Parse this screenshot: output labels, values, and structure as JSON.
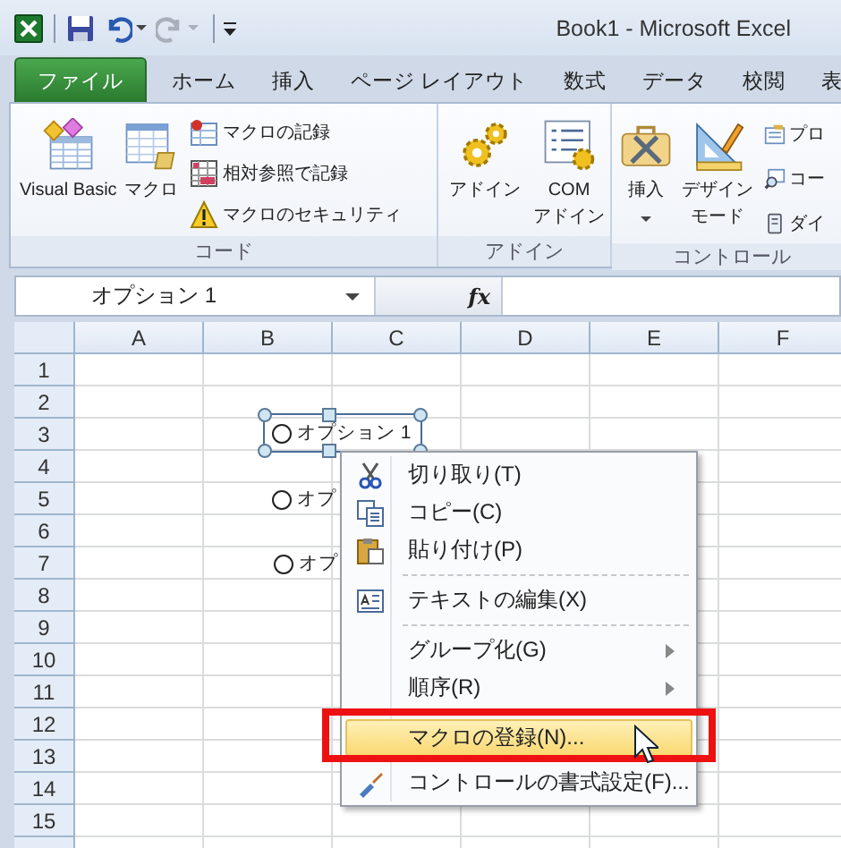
{
  "title_bar": {
    "title": "Book1  -  Microsoft Excel"
  },
  "quick_access": [
    {
      "kind": "save",
      "disabled": false,
      "dropdown": false
    },
    {
      "kind": "undo",
      "disabled": false,
      "dropdown": true
    },
    {
      "kind": "redo",
      "disabled": true,
      "dropdown": true
    },
    {
      "kind": "customize",
      "disabled": false,
      "dropdown": false
    }
  ],
  "tabs": [
    {
      "label": "ファイル",
      "kind": "file",
      "selected": false
    },
    {
      "label": "ホーム",
      "kind": "tab",
      "selected": false
    },
    {
      "label": "挿入",
      "kind": "tab",
      "selected": false
    },
    {
      "label": "ページ レイアウト",
      "kind": "tab",
      "selected": false
    },
    {
      "label": "数式",
      "kind": "tab",
      "selected": false
    },
    {
      "label": "データ",
      "kind": "tab",
      "selected": false
    },
    {
      "label": "校閲",
      "kind": "tab",
      "selected": false
    },
    {
      "label": "表",
      "kind": "tab",
      "selected": false
    }
  ],
  "ribbon": {
    "groups": [
      {
        "label": "コード",
        "large_buttons": [
          {
            "lines": [
              "Visual Basic"
            ],
            "dropdown": false
          },
          {
            "lines": [
              "マクロ"
            ],
            "dropdown": false
          }
        ],
        "small_buttons": [
          "マクロの記録",
          "相対参照で記録",
          "マクロのセキュリティ"
        ]
      },
      {
        "label": "アドイン",
        "large_buttons": [
          {
            "lines": [
              "アドイン"
            ],
            "dropdown": false
          },
          {
            "lines": [
              "COM",
              "アドイン"
            ],
            "dropdown": false
          }
        ]
      },
      {
        "label": "コントロール",
        "large_buttons": [
          {
            "lines": [
              "挿入"
            ],
            "dropdown": true
          },
          {
            "lines": [
              "デザイン",
              "モード"
            ],
            "dropdown": false
          }
        ],
        "small_buttons": [
          "プロ",
          "コー",
          "ダイ"
        ]
      }
    ]
  },
  "formula_bar": {
    "name_box": "オプション 1",
    "function_button": "fx"
  },
  "sheet": {
    "columns": [
      "A",
      "B",
      "C",
      "D",
      "E",
      "F"
    ],
    "rows": [
      "1",
      "2",
      "3",
      "4",
      "5",
      "6",
      "7",
      "8",
      "9",
      "10",
      "11",
      "12",
      "13",
      "14",
      "15"
    ]
  },
  "option_buttons": [
    {
      "label": "オプション 1",
      "checked": false,
      "selected": true
    },
    {
      "label": "オプ",
      "checked": false,
      "selected": false
    },
    {
      "label": "オプ",
      "checked": false,
      "selected": false
    }
  ],
  "context_menu": {
    "items": [
      {
        "kind": "command",
        "label": "切り取り(T)",
        "submenu": false,
        "highlighted": false
      },
      {
        "kind": "command",
        "label": "コピー(C)",
        "submenu": false,
        "highlighted": false
      },
      {
        "kind": "command",
        "label": "貼り付け(P)",
        "submenu": false,
        "highlighted": false
      },
      {
        "kind": "separator"
      },
      {
        "kind": "command",
        "label": "テキストの編集(X)",
        "submenu": false,
        "highlighted": false
      },
      {
        "kind": "separator"
      },
      {
        "kind": "command",
        "label": "グループ化(G)",
        "submenu": true,
        "highlighted": false
      },
      {
        "kind": "command",
        "label": "順序(R)",
        "submenu": true,
        "highlighted": false
      },
      {
        "kind": "separator"
      },
      {
        "kind": "command",
        "label": "マクロの登録(N)...",
        "submenu": false,
        "highlighted": true
      },
      {
        "kind": "command",
        "label": "コントロールの書式設定(F)...",
        "submenu": false,
        "highlighted": false
      }
    ]
  }
}
